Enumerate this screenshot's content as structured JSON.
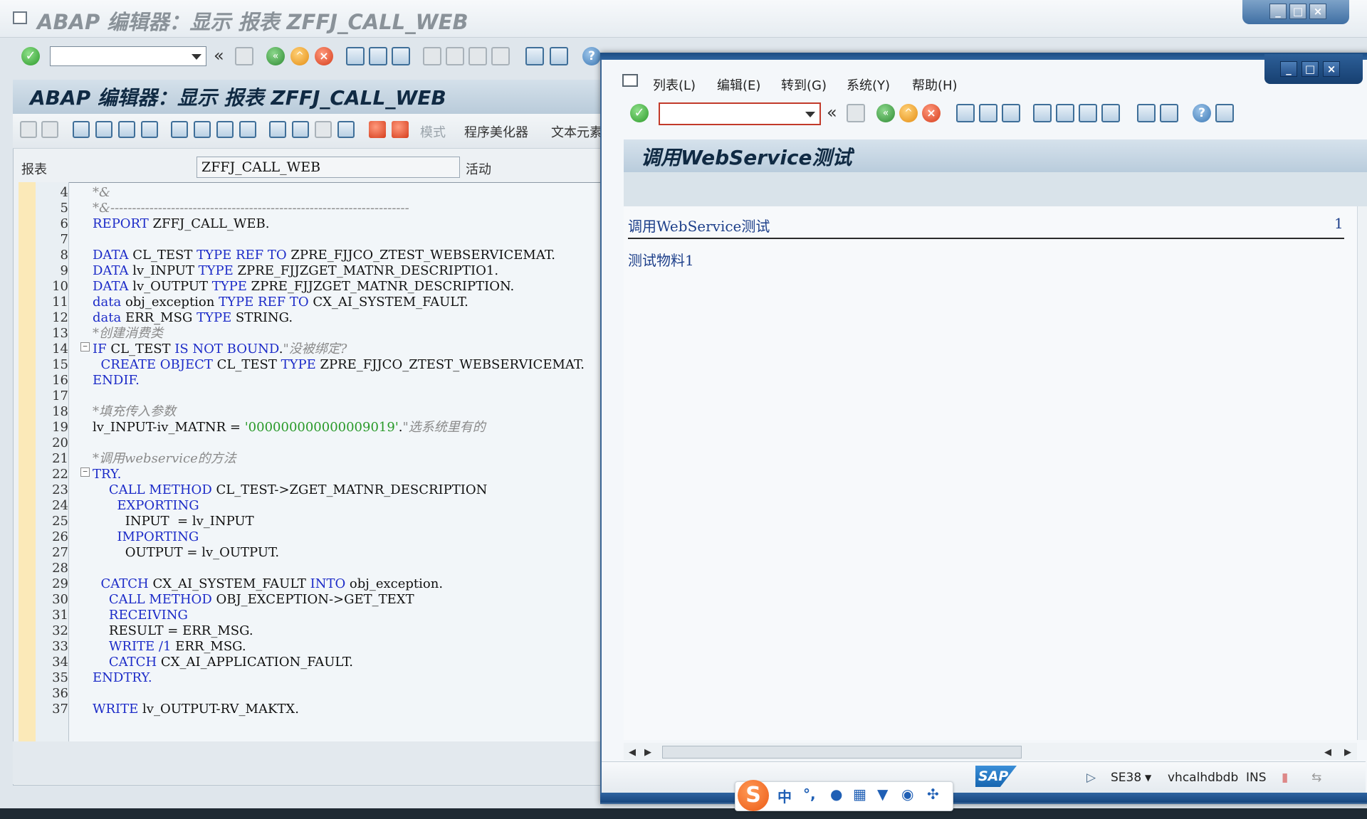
{
  "background_window": {
    "title": "ABAP 编辑器：显示 报表 ZFFJ_CALL_WEB",
    "panel_title": "ABAP 编辑器：显示 报表 ZFFJ_CALL_WEB",
    "toolbar_text": {
      "pattern": "模式",
      "pretty_printer": "程序美化器",
      "text_elements": "文本元素"
    },
    "report_label": "报表",
    "report_value": "ZFFJ_CALL_WEB",
    "report_status": "活动",
    "line_numbers": [
      "4",
      "5",
      "6",
      "7",
      "8",
      "9",
      "10",
      "11",
      "12",
      "13",
      "14",
      "15",
      "16",
      "17",
      "18",
      "19",
      "20",
      "21",
      "22",
      "23",
      "24",
      "25",
      "26",
      "27",
      "28",
      "29",
      "30",
      "31",
      "32",
      "33",
      "34",
      "35",
      "36",
      "37"
    ],
    "code": {
      "l4": "*&",
      "l5": "*&---------------------------------------------------------------------",
      "l6a": "REPORT",
      "l6b": " ZFFJ_CALL_WEB.",
      "l8a": "DATA",
      "l8b": " CL_TEST ",
      "l8c": "TYPE REF TO",
      "l8d": " ZPRE_FJJCO_ZTEST_WEBSERVICEMAT.",
      "l9a": "DATA",
      "l9b": " lv_INPUT ",
      "l9c": "TYPE",
      "l9d": " ZPRE_FJJZGET_MATNR_DESCRIPTIO1.",
      "l10a": "DATA",
      "l10b": " lv_OUTPUT ",
      "l10c": "TYPE",
      "l10d": " ZPRE_FJJZGET_MATNR_DESCRIPTION.",
      "l11a": "data",
      "l11b": " obj_exception ",
      "l11c": "TYPE REF TO",
      "l11d": " CX_AI_SYSTEM_FAULT.",
      "l12a": "data",
      "l12b": " ERR_MSG ",
      "l12c": "TYPE",
      "l12d": " STRING.",
      "l13": "*创建消费类",
      "l14a": "IF",
      "l14b": " CL_TEST ",
      "l14c": "IS NOT BOUND",
      "l14d": ".",
      "l14e": "\"没被绑定?",
      "l15a": "  CREATE OBJECT",
      "l15b": " CL_TEST ",
      "l15c": "TYPE",
      "l15d": " ZPRE_FJJCO_ZTEST_WEBSERVICEMAT.",
      "l16": "ENDIF.",
      "l18": "*填充传入参数",
      "l19a": "lv_INPUT-iv_MATNR = ",
      "l19b": "'000000000000009019'",
      "l19c": ".",
      "l19d": "\"选系统里有的",
      "l21": "*调用webservice的方法",
      "l22": "TRY.",
      "l23a": "    CALL METHOD",
      "l23b": " CL_TEST->ZGET_MATNR_DESCRIPTION",
      "l24": "      EXPORTING",
      "l25": "        INPUT  = lv_INPUT",
      "l26": "      IMPORTING",
      "l27": "        OUTPUT = lv_OUTPUT.",
      "l29a": "  CATCH",
      "l29b": " CX_AI_SYSTEM_FAULT ",
      "l29c": "INTO",
      "l29d": " obj_exception.",
      "l30a": "    CALL METHOD",
      "l30b": " OBJ_EXCEPTION->GET_TEXT",
      "l31": "    RECEIVING",
      "l32": "    RESULT = ERR_MSG.",
      "l33a": "    WRITE",
      "l33b": " /1",
      "l33c": " ERR_MSG.",
      "l34a": "    CATCH",
      "l34b": " CX_AI_APPLICATION_FAULT.",
      "l35": "ENDTRY.",
      "l37a": "WRITE",
      "l37b": " lv_OUTPUT-RV_MAKTX."
    }
  },
  "foreground_window": {
    "menu": [
      "列表(L)",
      "编辑(E)",
      "转到(G)",
      "系统(Y)",
      "帮助(H)"
    ],
    "title": "调用WebService测试",
    "list_header": "调用WebService测试",
    "list_page": "1",
    "list_row": "测试物料1",
    "status": {
      "transaction": "SE38",
      "server": "vhcalhdbdb",
      "mode": "INS",
      "sap_logo": "SAP"
    }
  },
  "ime": {
    "logo": "S",
    "lang": "中",
    "punct": "°,"
  },
  "icons": {
    "back": "«",
    "ok": "✓",
    "help": "?"
  }
}
